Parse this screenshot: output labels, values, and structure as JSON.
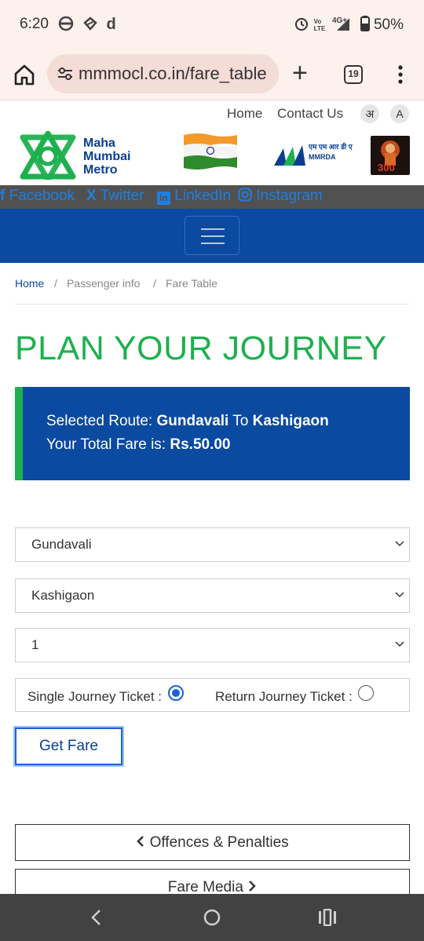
{
  "status_bar": {
    "time": "6:20",
    "left_icons": [
      "notification-icon",
      "notification-icon",
      "d"
    ],
    "network_small": "Vo LTE",
    "network_type": "4G+",
    "battery": "50%"
  },
  "browser": {
    "url": "mmmocl.co.in/fare_table",
    "tab_count": "19"
  },
  "header": {
    "top_links": [
      "Home",
      "Contact Us"
    ],
    "lang_hindi": "अ",
    "lang_english": "A",
    "logo_text": [
      "Maha",
      "Mumbai",
      "Metro"
    ],
    "mmrda_text_hindi": "एम एम आर डी ए",
    "mmrda_text": "MMRDA",
    "poster_text": "300"
  },
  "social": {
    "facebook": "Facebook",
    "twitter": "Twitter",
    "linkedin": "LinkedIn",
    "instagram": "Instagram",
    "link_color": "#1f7fe0"
  },
  "breadcrumb": {
    "home": "Home",
    "sep": "/",
    "passenger": "Passenger info",
    "current": "Fare Table"
  },
  "main": {
    "title": "PLAN YOUR JOURNEY",
    "selected_route_label": "Selected Route:",
    "from": "Gundavali",
    "to_word": "To",
    "to": "Kashigaon",
    "total_fare_label": "Your Total Fare is:",
    "total_fare": "Rs.50.00",
    "from_select": "Gundavali",
    "to_select": "Kashigaon",
    "count_select": "1",
    "single_label": "Single Journey Ticket :",
    "return_label": "Return Journey Ticket :",
    "single_selected": true,
    "get_fare": "Get Fare",
    "offences": "Offences & Penalties",
    "fare_media": "Fare Media"
  },
  "colors": {
    "brand_green": "#1eb04f",
    "brand_blue": "#0a4aa0",
    "chrome_bg": "#fdf1ee"
  }
}
